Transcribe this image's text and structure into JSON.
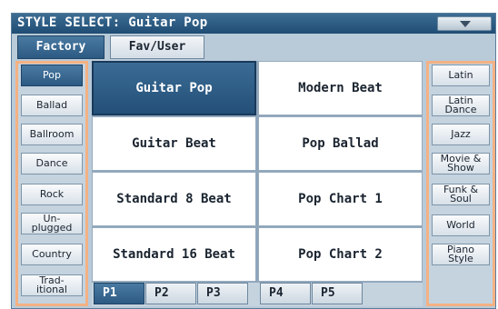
{
  "title": "STYLE SELECT: Guitar Pop",
  "menu_icon": "triangle-down-icon",
  "top_tabs": [
    "Factory",
    "Fav/User"
  ],
  "left_buttons": [
    "Pop",
    "Ballad",
    "Ballroom",
    "Dance",
    "Rock",
    "Un-\nplugged",
    "Country",
    "Trad-\nitional"
  ],
  "right_buttons": [
    "Latin",
    "Latin\nDance",
    "Jazz",
    "Movie &\nShow",
    "Funk &\nSoul",
    "World",
    "Piano\nStyle"
  ],
  "styles": [
    "Guitar Pop",
    "Modern Beat",
    "Guitar Beat",
    "Pop Ballad",
    "Standard 8 Beat",
    "Pop Chart 1",
    "Standard 16 Beat",
    "Pop Chart 2"
  ],
  "pages": [
    "P1",
    "P2",
    "P3",
    "P4",
    "P5"
  ],
  "selected": {
    "top_tab": "Factory",
    "category": "Pop",
    "style": "Guitar Pop",
    "page": "P1"
  },
  "colors": {
    "accent": "#2c5a82",
    "highlight_frame": "#f4b183"
  }
}
